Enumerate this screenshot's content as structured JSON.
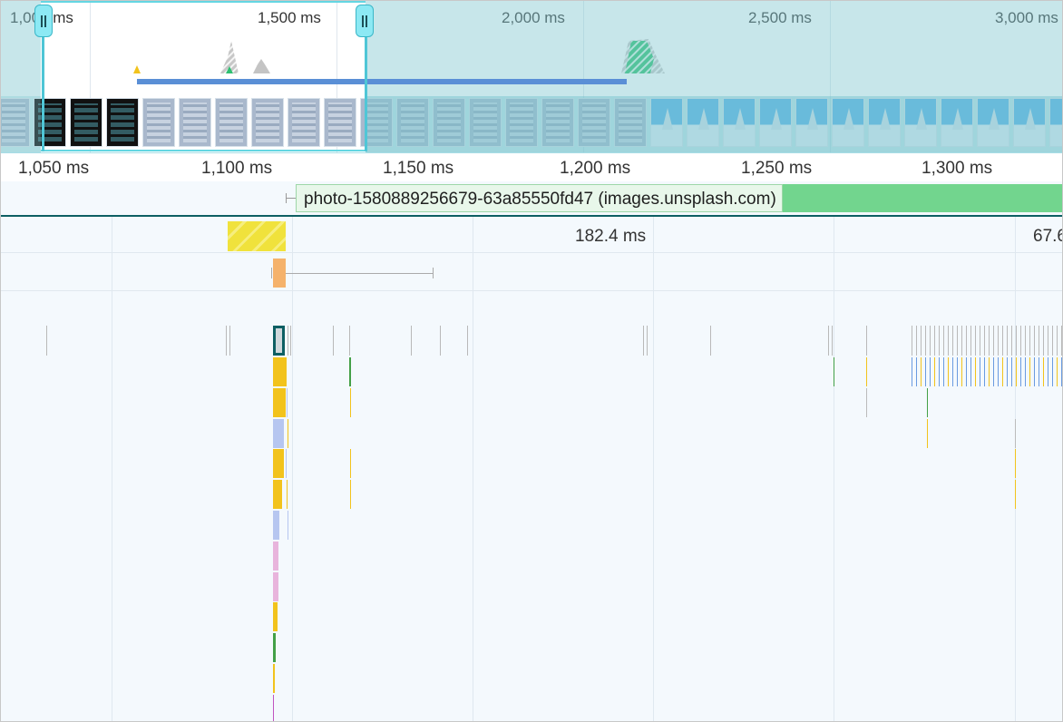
{
  "overview": {
    "tick_labels": [
      "1,000 ms",
      "1,500 ms",
      "2,000 ms",
      "2,500 ms",
      "3,000 ms"
    ]
  },
  "ruler": {
    "tick_labels": [
      "1,050 ms",
      "1,100 ms",
      "1,150 ms",
      "1,200 ms",
      "1,250 ms",
      "1,300 ms"
    ]
  },
  "network": {
    "request_label": "photo-1580889256679-63a85550fd47 (images.unsplash.com)"
  },
  "timings": {
    "duration_1": "182.4 ms",
    "duration_2": "67.6"
  },
  "colors": {
    "selection_border": "#64d6e2",
    "network_request": "#72d58e",
    "scripting": "#f2c31c",
    "rendering": "#b6c6f0",
    "painting": "#e8b4dc",
    "loading": "#f5b26b"
  }
}
